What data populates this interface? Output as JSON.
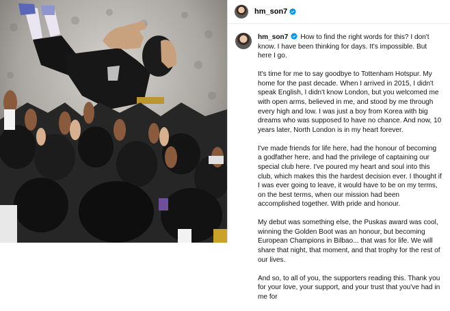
{
  "post": {
    "username": "hm_son7",
    "caption_paragraphs": [
      "How to find the right words for this? I don't know. I have been thinking for days. It's impossible. But here I go.",
      "It's time for me to say goodbye to Tottenham Hotspur. My home for the past decade. When I arrived in 2015, I didn't speak English, I didn't know London, but you welcomed me with open arms, believed in me, and stood by me through every high and low. I was just a boy from Korea with big dreams who was supposed to have no chance. And now, 10 years later, North London is in my heart forever.",
      "I've made friends for life here, had the honour of becoming a godfather here, and had the privilege of captaining our special club here. I've poured my heart and soul into this club, which makes this the hardest decision ever. I thought if I was ever going to leave, it would have to be on my terms, on the best terms, when our mission had been accomplished together. With pride and honour.",
      "My debut was something else, the Puskas award was cool, winning the Golden Boot was an honour, but becoming European Champions in Bilbao... that was for life. We will share that night, that moment, and that trophy for the rest of our lives.",
      "And so, to all of you, the supporters reading this. Thank you for your love, your support, and your trust that you've had in me for"
    ]
  },
  "icons": {
    "verified": "verified-badge-icon",
    "verified_color": "#0095f6"
  }
}
